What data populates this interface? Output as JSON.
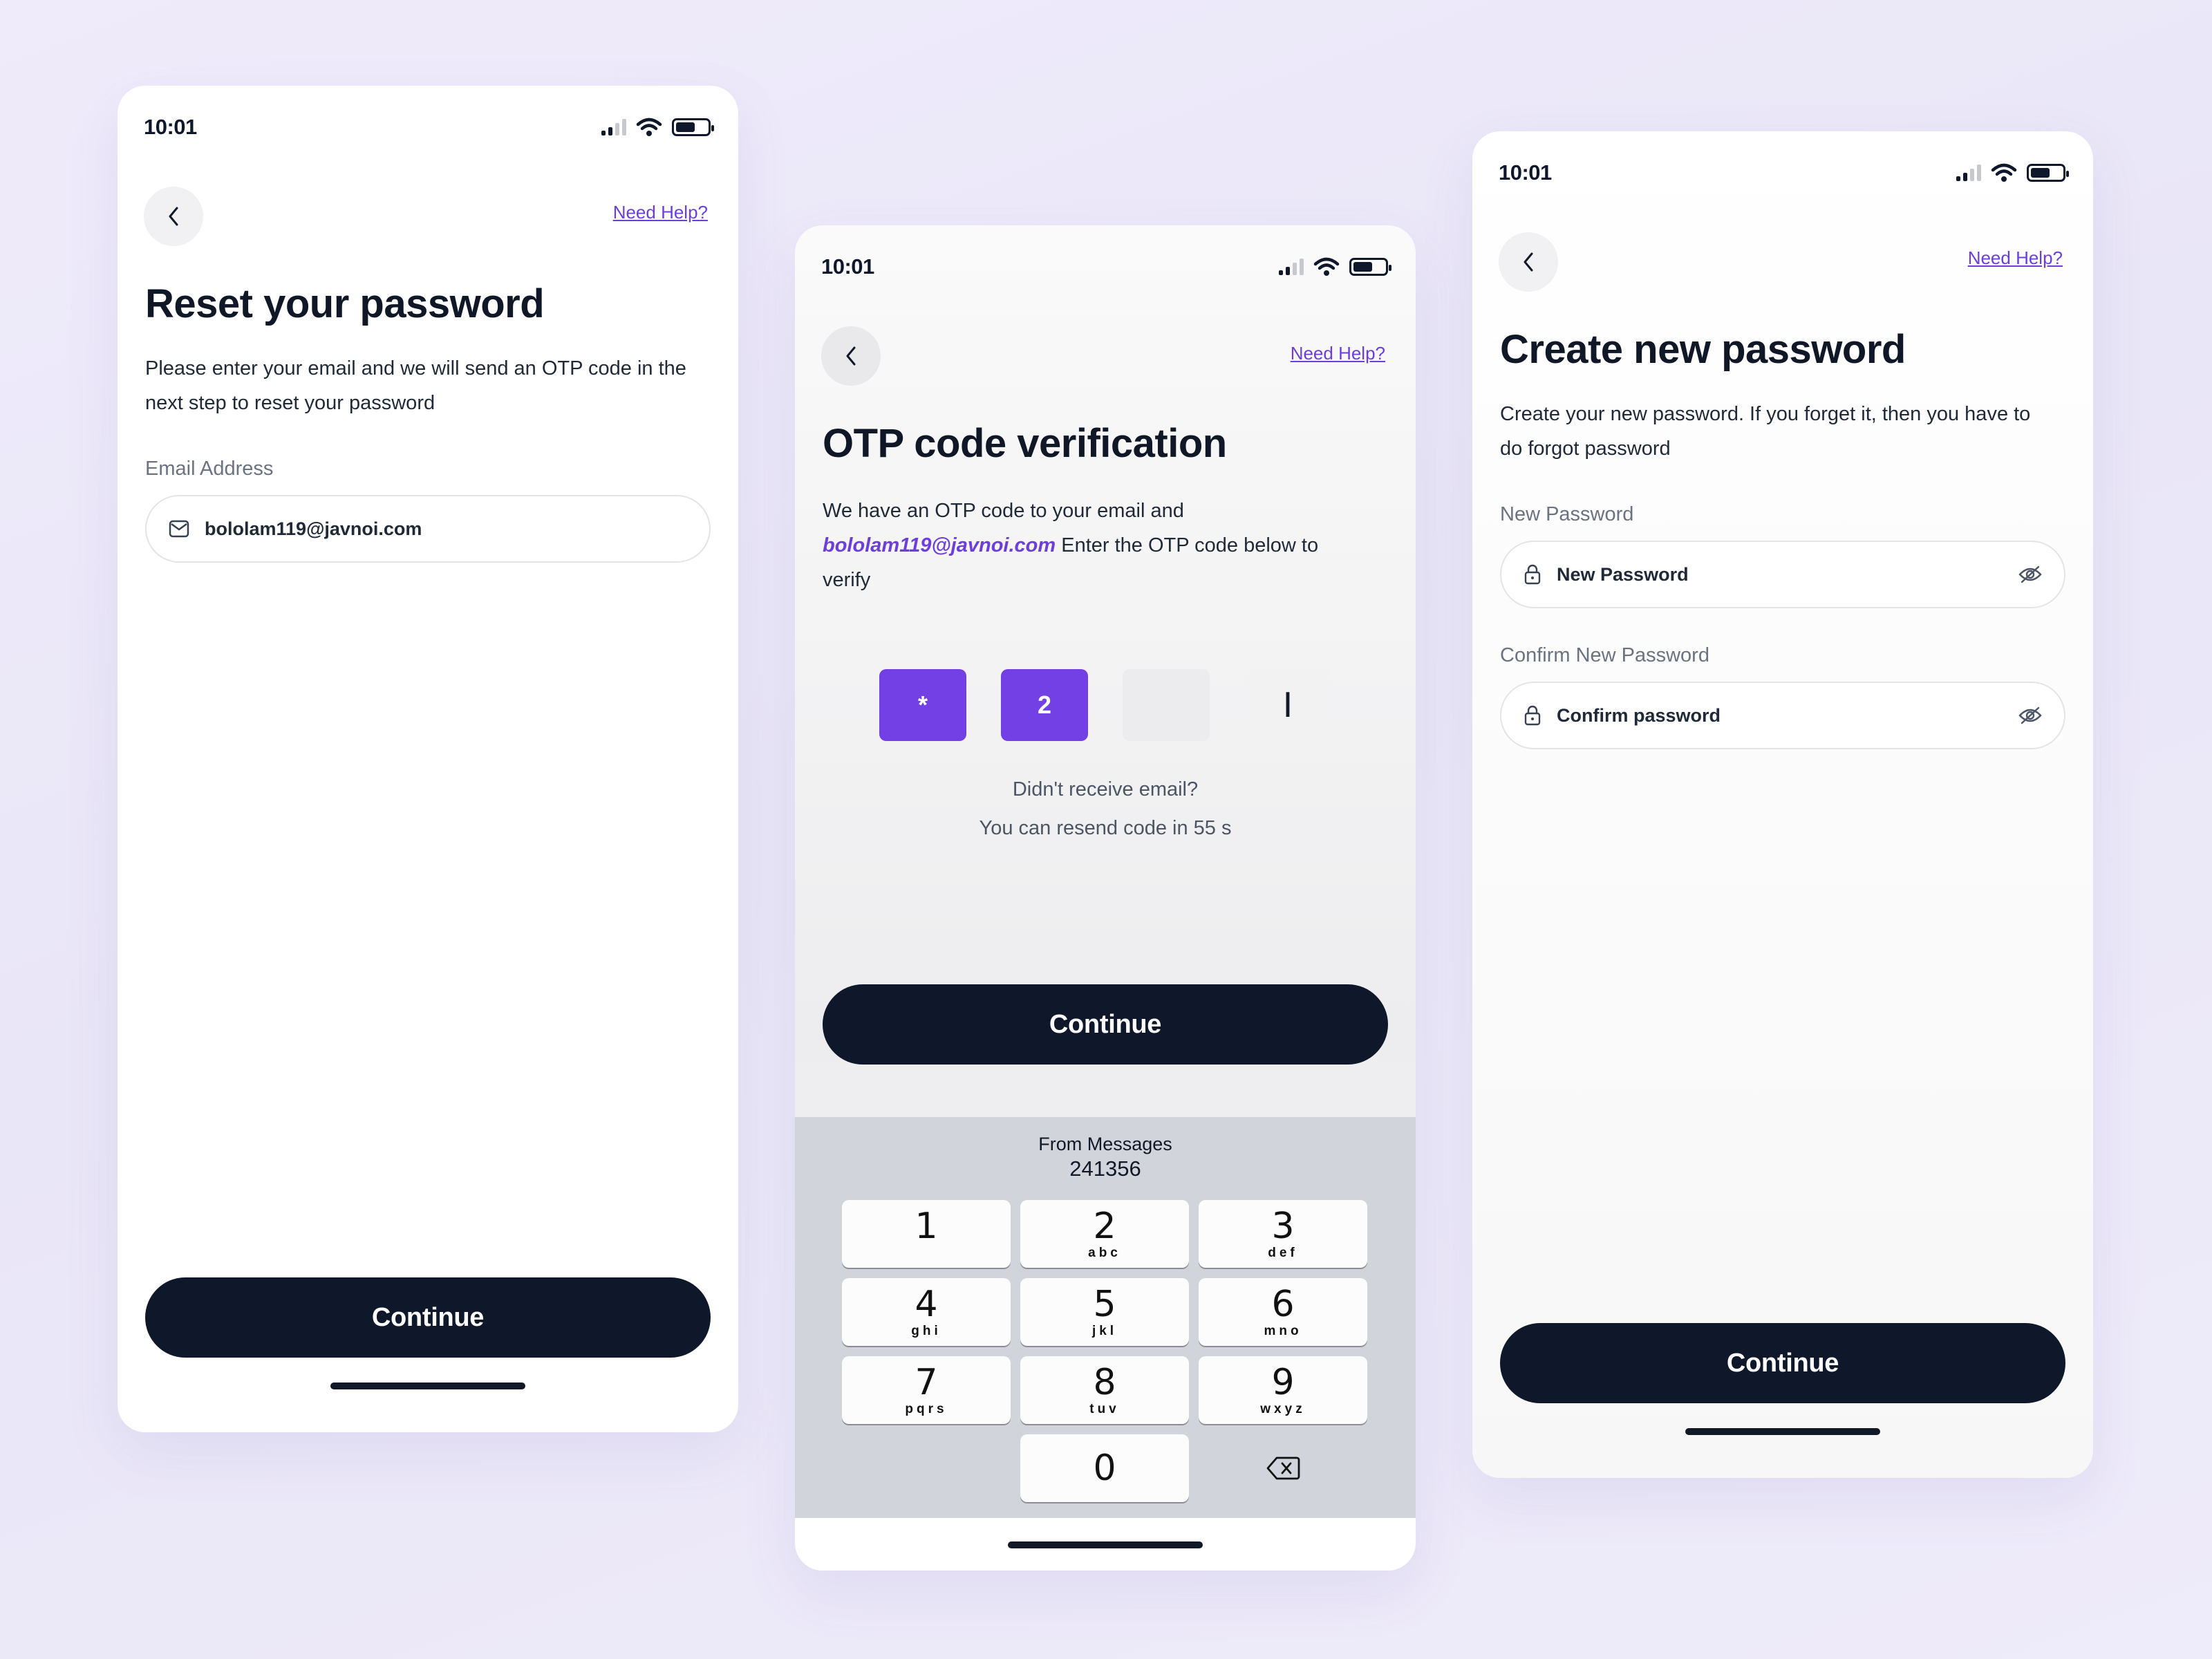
{
  "colors": {
    "accent": "#7240e5",
    "primary_button": "#0f172a",
    "background": "#efebfb"
  },
  "screens": [
    {
      "status_time": "10:01",
      "need_help": "Need Help?",
      "title": "Reset your password",
      "description": "Please enter your email and we will send an OTP code in the next step to reset your password",
      "email_label": "Email Address",
      "email_value": "bololam119@javnoi.com",
      "continue_label": "Continue"
    },
    {
      "status_time": "10:01",
      "need_help": "Need Help?",
      "title": "OTP code verification",
      "description_prefix": "We have an OTP code to your email and",
      "email": "bololam119@javnoi.com",
      "description_suffix": "Enter the OTP code below to verify",
      "otp_digits": [
        "*",
        "2",
        "",
        "I"
      ],
      "resend_question": "Didn't receive email?",
      "resend_timer": "You can resend code in 55 s",
      "continue_label": "Continue",
      "keyboard": {
        "suggestion_from": "From Messages",
        "suggestion_code": "241356",
        "keys": [
          {
            "num": "1",
            "letters": ""
          },
          {
            "num": "2",
            "letters": "abc"
          },
          {
            "num": "3",
            "letters": "def"
          },
          {
            "num": "4",
            "letters": "ghi"
          },
          {
            "num": "5",
            "letters": "jkl"
          },
          {
            "num": "6",
            "letters": "mno"
          },
          {
            "num": "7",
            "letters": "pqrs"
          },
          {
            "num": "8",
            "letters": "tuv"
          },
          {
            "num": "9",
            "letters": "wxyz"
          },
          {
            "num": "0",
            "letters": ""
          }
        ]
      }
    },
    {
      "status_time": "10:01",
      "need_help": "Need Help?",
      "title": "Create new password",
      "description": "Create your new password. If you forget it, then you have to do forgot password",
      "new_password_label": "New Password",
      "new_password_placeholder": "New Password",
      "confirm_label": "Confirm New Password",
      "confirm_placeholder": "Confirm password",
      "continue_label": "Continue"
    }
  ]
}
